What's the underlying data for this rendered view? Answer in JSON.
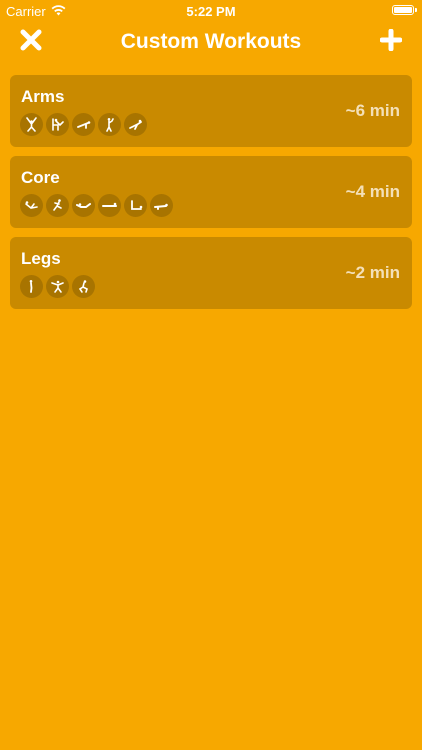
{
  "status_bar": {
    "carrier": "Carrier",
    "time": "5:22 PM",
    "wifi_icon": "wifi-icon",
    "battery_icon": "battery-icon"
  },
  "nav": {
    "title": "Custom Workouts",
    "close_icon": "close-icon",
    "add_icon": "plus-icon"
  },
  "workouts": [
    {
      "name": "Arms",
      "duration": "~6 min",
      "exercise_icons": [
        "exercise-jumping-jack-icon",
        "exercise-chair-dip-icon",
        "exercise-pushup-icon",
        "exercise-arm-curl-icon",
        "exercise-plank-icon"
      ]
    },
    {
      "name": "Core",
      "duration": "~4 min",
      "exercise_icons": [
        "exercise-crunch-icon",
        "exercise-bicycle-icon",
        "exercise-superman-icon",
        "exercise-side-plank-icon",
        "exercise-leg-raise-icon",
        "exercise-plank-icon"
      ]
    },
    {
      "name": "Legs",
      "duration": "~2 min",
      "exercise_icons": [
        "exercise-calf-raise-icon",
        "exercise-lunge-icon",
        "exercise-squat-icon"
      ]
    }
  ],
  "colors": {
    "background": "#F7A800",
    "card": "#C98A00",
    "icon_circle": "#A87400",
    "duration_text": "#F4E0B8"
  }
}
